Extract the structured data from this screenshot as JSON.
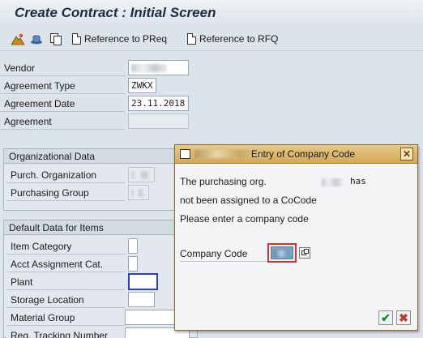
{
  "header": {
    "title": "Create Contract : Initial Screen"
  },
  "toolbar": {
    "ref_preq_label": "Reference to PReq",
    "ref_rfq_label": "Reference to RFQ"
  },
  "form": {
    "vendor_label": "Vendor",
    "agreement_type_label": "Agreement Type",
    "agreement_type_value": "ZWKX",
    "agreement_date_label": "Agreement Date",
    "agreement_date_value": "23.11.2018",
    "agreement_label": "Agreement",
    "agreement_value": ""
  },
  "org_data": {
    "title": "Organizational Data",
    "purch_org_label": "Purch. Organization",
    "purch_group_label": "Purchasing Group"
  },
  "default_data": {
    "title": "Default Data for Items",
    "item_category_label": "Item Category",
    "acct_assignment_label": "Acct Assignment Cat.",
    "plant_label": "Plant",
    "storage_location_label": "Storage Location",
    "material_group_label": "Material Group",
    "req_tracking_label": "Req. Tracking Number"
  },
  "dialog": {
    "title": "Entry of Company Code",
    "line1_prefix": "The purchasing org.",
    "line1_suffix": "has",
    "line2": "not been assigned to a CoCode",
    "line3": "Please enter a company code",
    "company_code_label": "Company Code",
    "close_glyph": "✕",
    "ok_glyph": "✔",
    "cancel_glyph": "✖"
  }
}
